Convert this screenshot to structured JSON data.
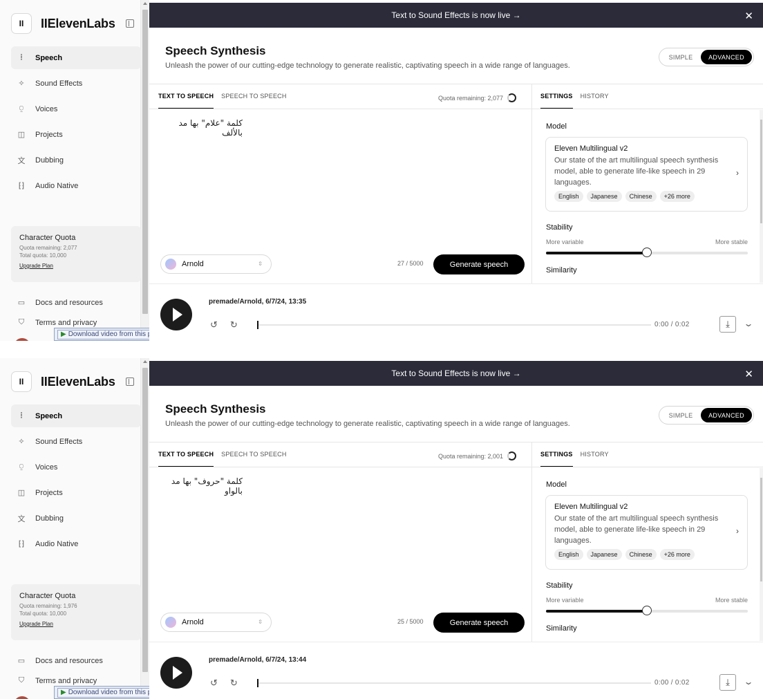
{
  "frames": [
    {
      "brand": "IIElevenLabs",
      "nav": [
        "Speech",
        "Sound Effects",
        "Voices",
        "Projects",
        "Dubbing",
        "Audio Native"
      ],
      "quota": {
        "title": "Character Quota",
        "remaining": "Quota remaining: 2,077",
        "total": "Total quota: 10,000",
        "upgrade": "Upgrade Plan"
      },
      "links": [
        "Docs and resources",
        "Terms and privacy"
      ],
      "download_bar": {
        "label": "Download video from this page",
        "ctrl": "? ✕"
      },
      "banner": "Text to Sound Effects is now live  →",
      "title": "Speech Synthesis",
      "subtitle": "Unleash the power of our cutting-edge technology to generate realistic, captivating speech in a wide range of languages.",
      "mode": {
        "simple": "SIMPLE",
        "advanced": "ADVANCED"
      },
      "tabs_left": [
        "TEXT TO SPEECH",
        "SPEECH TO SPEECH"
      ],
      "quota_remaining": "Quota remaining: 2,077",
      "editor_text": "كلمة \"علام\" بها مد بالألف",
      "voice": "Arnold",
      "char_count": "27 / 5000",
      "generate": "Generate speech",
      "tabs_right": [
        "SETTINGS",
        "HISTORY"
      ],
      "model_label": "Model",
      "model": {
        "name": "Eleven Multilingual v2",
        "desc": "Our state of the art multilingual speech synthesis model, able to generate life-like speech in 29 languages.",
        "chips": [
          "English",
          "Japanese",
          "Chinese",
          "+26 more"
        ]
      },
      "stability": {
        "label": "Stability",
        "left": "More variable",
        "right": "More stable",
        "value": 0.5
      },
      "similarity_label": "Similarity",
      "player": {
        "title": "premade/Arnold, 6/7/24, 13:35",
        "time": "0:00  /  0:02"
      }
    },
    {
      "brand": "IIElevenLabs",
      "nav": [
        "Speech",
        "Sound Effects",
        "Voices",
        "Projects",
        "Dubbing",
        "Audio Native"
      ],
      "quota": {
        "title": "Character Quota",
        "remaining": "Quota remaining: 1,976",
        "total": "Total quota: 10,000",
        "upgrade": "Upgrade Plan"
      },
      "links": [
        "Docs and resources",
        "Terms and privacy"
      ],
      "download_bar": {
        "label": "Download video from this page",
        "ctrl": "? ✕"
      },
      "banner": "Text to Sound Effects is now live  →",
      "title": "Speech Synthesis",
      "subtitle": "Unleash the power of our cutting-edge technology to generate realistic, captivating speech in a wide range of languages.",
      "mode": {
        "simple": "SIMPLE",
        "advanced": "ADVANCED"
      },
      "tabs_left": [
        "TEXT TO SPEECH",
        "SPEECH TO SPEECH"
      ],
      "quota_remaining": "Quota remaining: 2,001",
      "editor_text": "كلمة \"حروف\" بها مد بالواو",
      "voice": "Arnold",
      "char_count": "25 / 5000",
      "generate": "Generate speech",
      "tabs_right": [
        "SETTINGS",
        "HISTORY"
      ],
      "model_label": "Model",
      "model": {
        "name": "Eleven Multilingual v2",
        "desc": "Our state of the art multilingual speech synthesis model, able to generate life-like speech in 29 languages.",
        "chips": [
          "English",
          "Japanese",
          "Chinese",
          "+26 more"
        ]
      },
      "stability": {
        "label": "Stability",
        "left": "More variable",
        "right": "More stable",
        "value": 0.5
      },
      "similarity_label": "Similarity",
      "player": {
        "title": "premade/Arnold, 6/7/24, 13:44",
        "time": "0:00  /  0:02"
      }
    }
  ]
}
